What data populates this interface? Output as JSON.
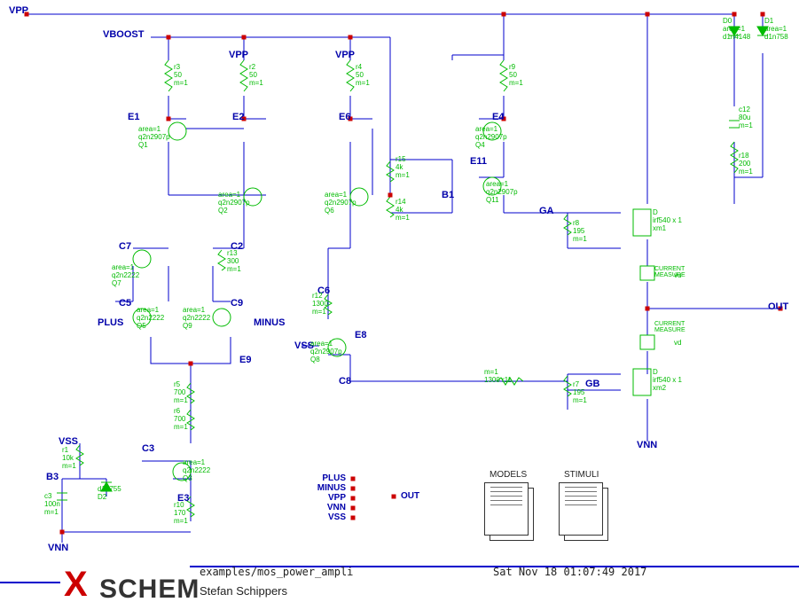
{
  "footer": {
    "path": "examples/mos_power_ampli",
    "author": "Stefan Schippers",
    "date": "Sat Nov 18 01:07:49 2017",
    "logo1": "X",
    "logo2": "SCHEM"
  },
  "nets": {
    "VPP": "VPP",
    "VBOOST": "VBOOST",
    "VNN": "VNN",
    "VSS": "VSS",
    "PLUS": "PLUS",
    "MINUS": "MINUS",
    "OUT": "OUT",
    "E1": "E1",
    "E2": "E2",
    "E3": "E3",
    "E4": "E4",
    "E6": "E6",
    "E8": "E8",
    "E9": "E9",
    "E11": "E11",
    "C2": "C2",
    "C3": "C3",
    "C5": "C5",
    "C6": "C6",
    "C7": "C7",
    "C8": "C8",
    "C9": "C9",
    "B1": "B1",
    "B3": "B3",
    "GA": "GA",
    "GB": "GB"
  },
  "components": {
    "D0": {
      "name": "D0",
      "params": "area=1\nd1n4148"
    },
    "D1": {
      "name": "D1",
      "params": "area=1\nd1n758"
    },
    "D2": {
      "name": "D2",
      "params": "d1n755"
    },
    "c12": {
      "name": "c12",
      "params": "80u\nm=1"
    },
    "c3": {
      "name": "c3",
      "params": "100n\nm=1"
    },
    "r1": {
      "name": "r1",
      "params": "10k\nm=1"
    },
    "r2": {
      "name": "r2",
      "params": "50\nm=1"
    },
    "r3": {
      "name": "r3",
      "params": "50\nm=1"
    },
    "r4": {
      "name": "r4",
      "params": "50\nm=1"
    },
    "r5": {
      "name": "r5",
      "params": "700\nm=1"
    },
    "r6": {
      "name": "r6",
      "params": "700\nm=1"
    },
    "r7": {
      "name": "r7",
      "params": "195\nm=1"
    },
    "r8": {
      "name": "r8",
      "params": "195\nm=1"
    },
    "r9": {
      "name": "r9",
      "params": "50\nm=1"
    },
    "r10": {
      "name": "r10",
      "params": "170\nm=1"
    },
    "r11": {
      "name": "r11",
      "params": "m=1\n1300"
    },
    "r12": {
      "name": "r12",
      "params": "1300\nm=1"
    },
    "r13": {
      "name": "r13",
      "params": "300\nm=1"
    },
    "r14": {
      "name": "r14",
      "params": "4k\nm=1"
    },
    "r15": {
      "name": "r15",
      "params": "4k\nm=1"
    },
    "r18": {
      "name": "r18",
      "params": "200\nm=1"
    },
    "Q1": {
      "name": "Q1",
      "params": "area=1\nq2n2907p"
    },
    "Q2": {
      "name": "Q2",
      "params": "area=1\nq2n2907p"
    },
    "Q3": {
      "name": "Q3",
      "params": "area=1\nq2n2222"
    },
    "Q4": {
      "name": "Q4",
      "params": "area=1\nq2n2907p"
    },
    "Q5": {
      "name": "Q5",
      "params": "area=1\nq2n2222"
    },
    "Q6": {
      "name": "Q6",
      "params": "area=1\nq2n2907p"
    },
    "Q7": {
      "name": "Q7",
      "params": "area=1\nq2n2222"
    },
    "Q8": {
      "name": "Q8",
      "params": "area=1\nq2n2907p"
    },
    "Q9": {
      "name": "Q9",
      "params": "area=1\nq2n2222"
    },
    "Q11": {
      "name": "Q11",
      "params": "area=1\nq2n2907p"
    },
    "xm1": {
      "name": "xm1",
      "params": "irf540 x 1"
    },
    "xm2": {
      "name": "xm2",
      "params": "irf540 x 1"
    },
    "vu": {
      "label": "CURRENT\nMEASURE",
      "node": "vu"
    },
    "vd": {
      "label": "CURRENT\nMEASURE",
      "node": "vd"
    }
  },
  "pinbox": {
    "inputs": [
      "PLUS",
      "MINUS",
      "VPP",
      "VNN",
      "VSS"
    ],
    "output": "OUT"
  },
  "docs": {
    "models": "MODELS",
    "stimuli": "STIMULI"
  }
}
